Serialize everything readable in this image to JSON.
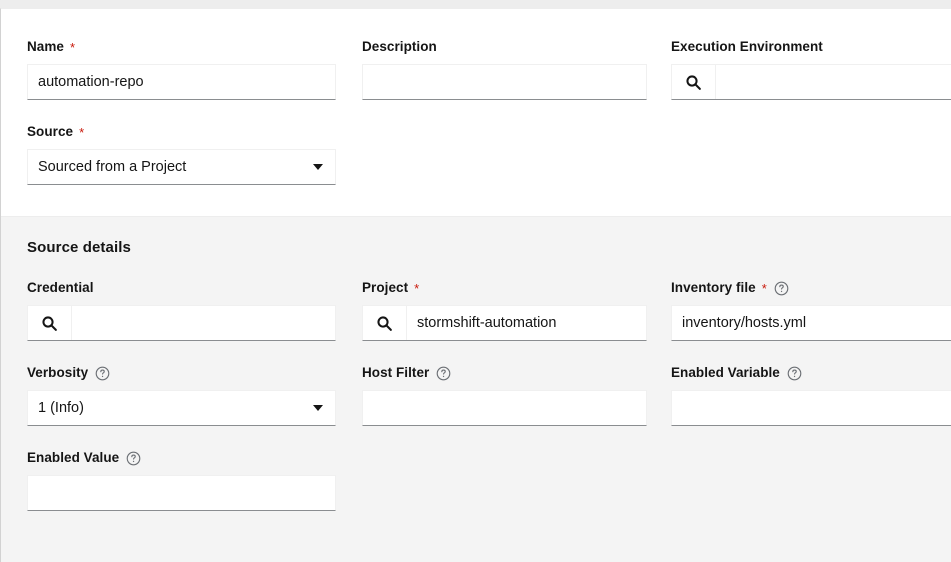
{
  "form": {
    "main_section": {
      "fields": [
        {
          "label": "Name",
          "required": true,
          "help": false,
          "type": "text",
          "value": "automation-repo",
          "name": "name"
        },
        {
          "label": "Description",
          "required": false,
          "help": false,
          "type": "text",
          "value": "",
          "name": "description"
        },
        {
          "label": "Execution Environment",
          "required": false,
          "help": false,
          "type": "lookup",
          "value": "",
          "icon": "search-icon",
          "name": "execution-environment"
        },
        {
          "label": "Source",
          "required": true,
          "help": false,
          "type": "select",
          "value": "Sourced from a Project",
          "icon": "chevron-down-icon",
          "name": "source"
        }
      ]
    },
    "source_details": {
      "title": "Source details",
      "fields": [
        {
          "label": "Credential",
          "required": false,
          "help": false,
          "type": "lookup",
          "value": "",
          "icon": "search-icon",
          "name": "credential"
        },
        {
          "label": "Project",
          "required": true,
          "help": false,
          "type": "lookup",
          "value": "stormshift-automation",
          "icon": "search-icon",
          "name": "project"
        },
        {
          "label": "Inventory file",
          "required": true,
          "help": true,
          "type": "select",
          "value": "inventory/hosts.yml",
          "icon": "chevron-down-icon",
          "name": "inventory-file"
        },
        {
          "label": "Verbosity",
          "required": false,
          "help": true,
          "type": "select",
          "value": "1 (Info)",
          "icon": "chevron-down-icon",
          "name": "verbosity"
        },
        {
          "label": "Host Filter",
          "required": false,
          "help": true,
          "type": "text",
          "value": "",
          "name": "host-filter"
        },
        {
          "label": "Enabled Variable",
          "required": false,
          "help": true,
          "type": "text",
          "value": "",
          "name": "enabled-variable"
        },
        {
          "label": "Enabled Value",
          "required": false,
          "help": true,
          "type": "text",
          "value": "",
          "name": "enabled-value"
        }
      ]
    }
  },
  "colors": {
    "required_asterisk": "#c9190b",
    "section_background": "#f4f4f4",
    "card_background": "#ffffff",
    "page_background": "#ededed",
    "input_underline": "#8a8d90",
    "text": "#151515",
    "help_icon": "#6a6e73"
  },
  "icons": {
    "search": "search-icon",
    "chevron_down": "chevron-down-icon",
    "help": "help-circle-icon"
  }
}
